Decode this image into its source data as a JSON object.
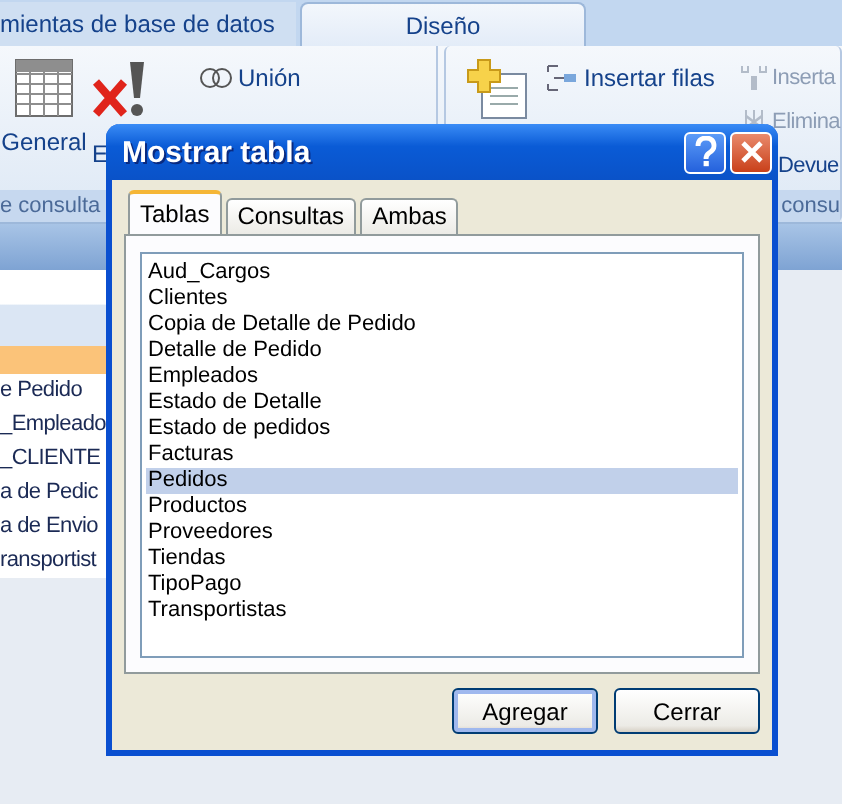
{
  "ribbon_tabs": [
    {
      "label": "mientas de base de datos",
      "selected": false
    },
    {
      "label": "Diseño",
      "selected": true
    }
  ],
  "ribbon_groups": [
    {
      "label": "e consulta",
      "large_buttons": [
        {
          "kind": "table",
          "label": "General"
        },
        {
          "kind": "run",
          "label": "E"
        }
      ],
      "small_button_columns": [
        [
          {
            "kind": "union",
            "label": "Unión",
            "disabled": false
          }
        ]
      ]
    },
    {
      "label": "consu",
      "large_buttons": [
        {
          "kind": "insert"
        }
      ],
      "small_button_columns": [
        [
          {
            "kind": "rows-insert",
            "label": "Insertar filas",
            "disabled": false
          }
        ],
        [
          {
            "kind": "col-insert",
            "label": "Inserta",
            "disabled": true
          },
          {
            "kind": "col-delete",
            "label": "Elimina",
            "disabled": true
          },
          {
            "kind": "return",
            "label": "Devue",
            "disabled": false
          }
        ]
      ]
    }
  ],
  "navigation": {
    "rows": [
      {
        "selected": true
      },
      {
        "label": "e Pedido",
        "selected": false
      },
      {
        "label": "_Empleado",
        "selected": false
      },
      {
        "label": "_CLIENTE",
        "selected": false
      },
      {
        "label": "a de Pedic",
        "selected": false
      },
      {
        "label": "a de Envio",
        "selected": false
      },
      {
        "label": "ransportist",
        "selected": false
      }
    ]
  },
  "dialog": {
    "title": "Mostrar tabla",
    "tabs": [
      {
        "label": "Tablas",
        "selected": true
      },
      {
        "label": "Consultas",
        "selected": false
      },
      {
        "label": "Ambas",
        "selected": false
      }
    ],
    "items": [
      {
        "label": "Aud_Cargos",
        "selected": false
      },
      {
        "label": "Clientes",
        "selected": false
      },
      {
        "label": "Copia de Detalle de Pedido",
        "selected": false
      },
      {
        "label": "Detalle de Pedido",
        "selected": false
      },
      {
        "label": "Empleados",
        "selected": false
      },
      {
        "label": "Estado de Detalle",
        "selected": false
      },
      {
        "label": "Estado de pedidos",
        "selected": false
      },
      {
        "label": "Facturas",
        "selected": false
      },
      {
        "label": "Pedidos",
        "selected": true
      },
      {
        "label": "Productos",
        "selected": false
      },
      {
        "label": "Proveedores",
        "selected": false
      },
      {
        "label": "Tiendas",
        "selected": false
      },
      {
        "label": "TipoPago",
        "selected": false
      },
      {
        "label": "Transportistas",
        "selected": false
      }
    ],
    "buttons": [
      {
        "label": "Agregar",
        "default": true
      },
      {
        "label": "Cerrar",
        "default": false
      }
    ]
  }
}
